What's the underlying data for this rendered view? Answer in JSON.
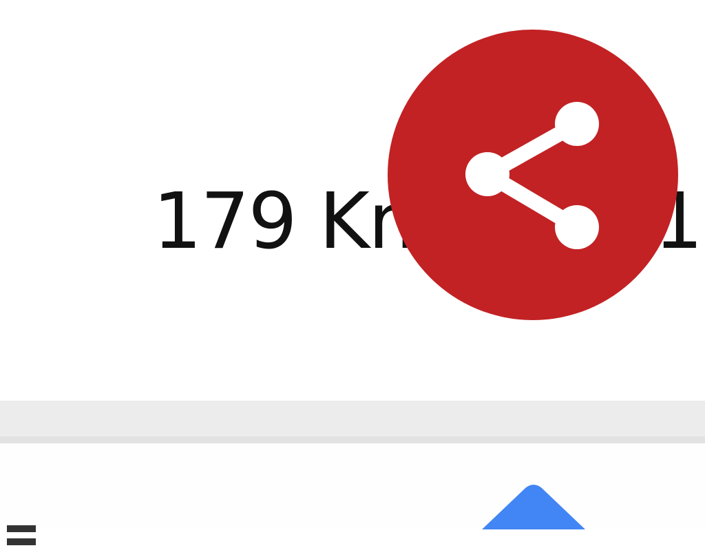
{
  "route": {
    "distance_text": "179 Km",
    "trailing_text": "1"
  },
  "share_button": {
    "icon": "share-icon",
    "color": "#c22224"
  },
  "navigation": {
    "icon": "navigation-arrow-icon",
    "color": "#4285f4"
  }
}
